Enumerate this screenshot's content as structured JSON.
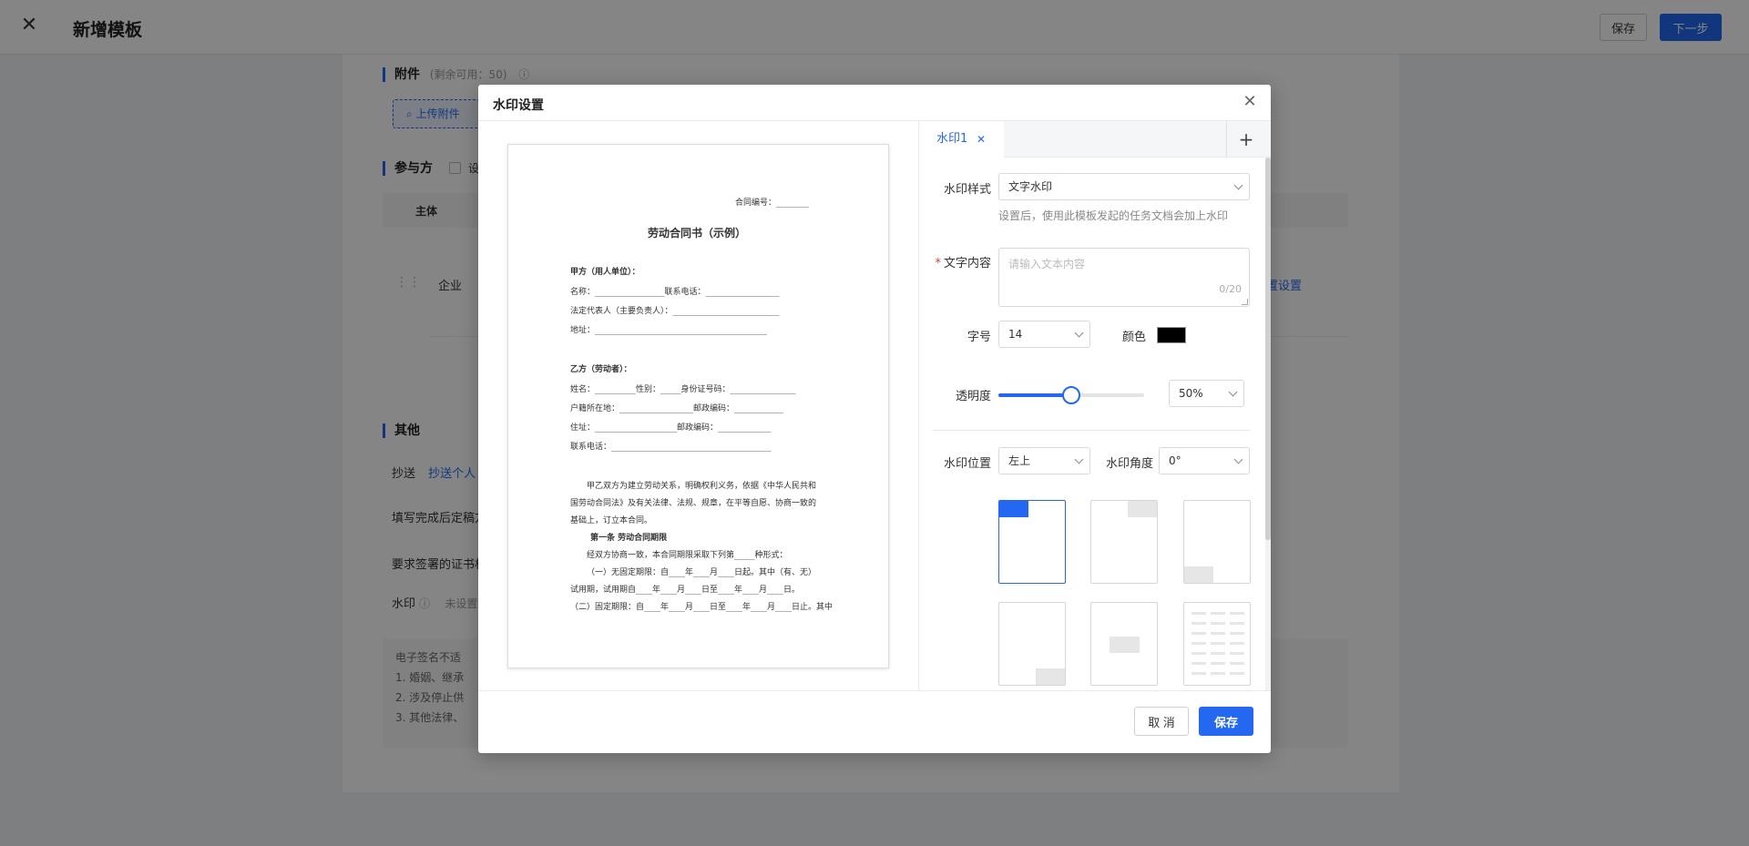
{
  "page": {
    "title": "新增模板",
    "save_label": "保存",
    "next_label": "下一步"
  },
  "background": {
    "attachment_title": "附件",
    "attachment_remaining": "(剩余可用：50)",
    "upload_label": "上传附件",
    "participants_title": "参与方",
    "participants_checkbox_label": "设",
    "column_subject": "主体",
    "row_enterprise": "企业",
    "row_settings_link": "置设置",
    "other_title": "其他",
    "cc_label": "抄送",
    "cc_link": "抄送个人",
    "after_fill_label": "填写完成后定稿方",
    "cert_label": "要求签署的证书机",
    "watermark_label": "水印",
    "watermark_value": "未设置",
    "notice_title": "电子签名不适",
    "notice_items": [
      "1. 婚姻、继承",
      "2. 涉及停止供",
      "3. 其他法律、"
    ]
  },
  "modal": {
    "title": "水印设置",
    "tab_label": "水印1",
    "style_label": "水印样式",
    "style_value": "文字水印",
    "style_hint": "设置后，使用此模板发起的任务文档会加上水印",
    "text_label": "文字内容",
    "text_placeholder": "请输入文本内容",
    "text_count": "0/20",
    "font_size_label": "字号",
    "font_size_value": "14",
    "color_label": "颜色",
    "color_value": "#000000",
    "opacity_label": "透明度",
    "opacity_value": "50%",
    "opacity_fraction": 0.5,
    "position_label": "水印位置",
    "position_value": "左上",
    "angle_label": "水印角度",
    "angle_value": "0°",
    "cancel_label": "取 消",
    "save_label": "保存"
  },
  "doc": {
    "contract_no": "合同编号：________",
    "title": "劳动合同书（示例）",
    "party_a": "甲方（用人单位）：",
    "a_name": "名称：_________________联系电话：__________________",
    "a_rep": "法定代表人（主要负责人）：__________________________",
    "a_addr": "地址：__________________________________________",
    "party_b": "乙方（劳动者）：",
    "b_name": "姓名：__________性别：_____身份证号码：________________",
    "b_hukou": "户籍所在地：__________________邮政编码：____________",
    "b_addr": "住址：____________________邮政编码：_____________",
    "b_phone": "联系电话：_______________________________________",
    "p1": "甲乙双方为建立劳动关系，明确权利义务，依据《中华人民共和",
    "p2": "国劳动合同法》及有关法律、法规、规章，在平等自愿、协商一致的",
    "p3": "基础上，订立本合同。",
    "art1": "第一条  劳动合同期限",
    "art1_1": "经双方协商一致，本合同期限采取下列第_____种形式：",
    "art1_2": "（一）无固定期限：自____年____月____日起。其中（有、无）",
    "art1_3": "试用期，试用期自____年____月____日至____年____月____日。",
    "art1_4": "（二）固定期限：自____年____月____日至____年____月____日止。其中"
  }
}
